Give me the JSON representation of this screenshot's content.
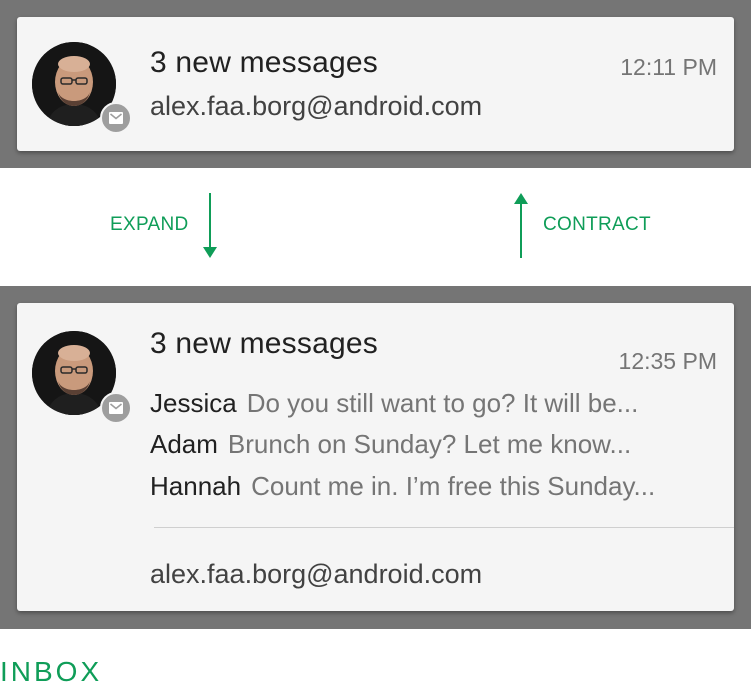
{
  "collapsed": {
    "title": "3 new messages",
    "time": "12:11 PM",
    "account": "alex.faa.borg@android.com"
  },
  "actions": {
    "expand_label": "EXPAND",
    "contract_label": "CONTRACT"
  },
  "expanded": {
    "title": "3 new messages",
    "time": "12:35 PM",
    "messages": [
      {
        "sender": "Jessica",
        "preview": "Do you still want to go? It will be..."
      },
      {
        "sender": "Adam",
        "preview": "Brunch on Sunday? Let me know..."
      },
      {
        "sender": "Hannah",
        "preview": "Count me in. I’m free this Sunday..."
      }
    ],
    "account": "alex.faa.borg@android.com"
  },
  "footer": {
    "label": "INBOX"
  },
  "icons": {
    "avatar": "person-avatar",
    "badge": "mail-icon",
    "expand": "arrow-down-icon",
    "contract": "arrow-up-icon"
  },
  "colors": {
    "accent": "#0f9d58",
    "band": "#757575",
    "card": "#f5f5f5",
    "badge": "#9e9e9e"
  }
}
